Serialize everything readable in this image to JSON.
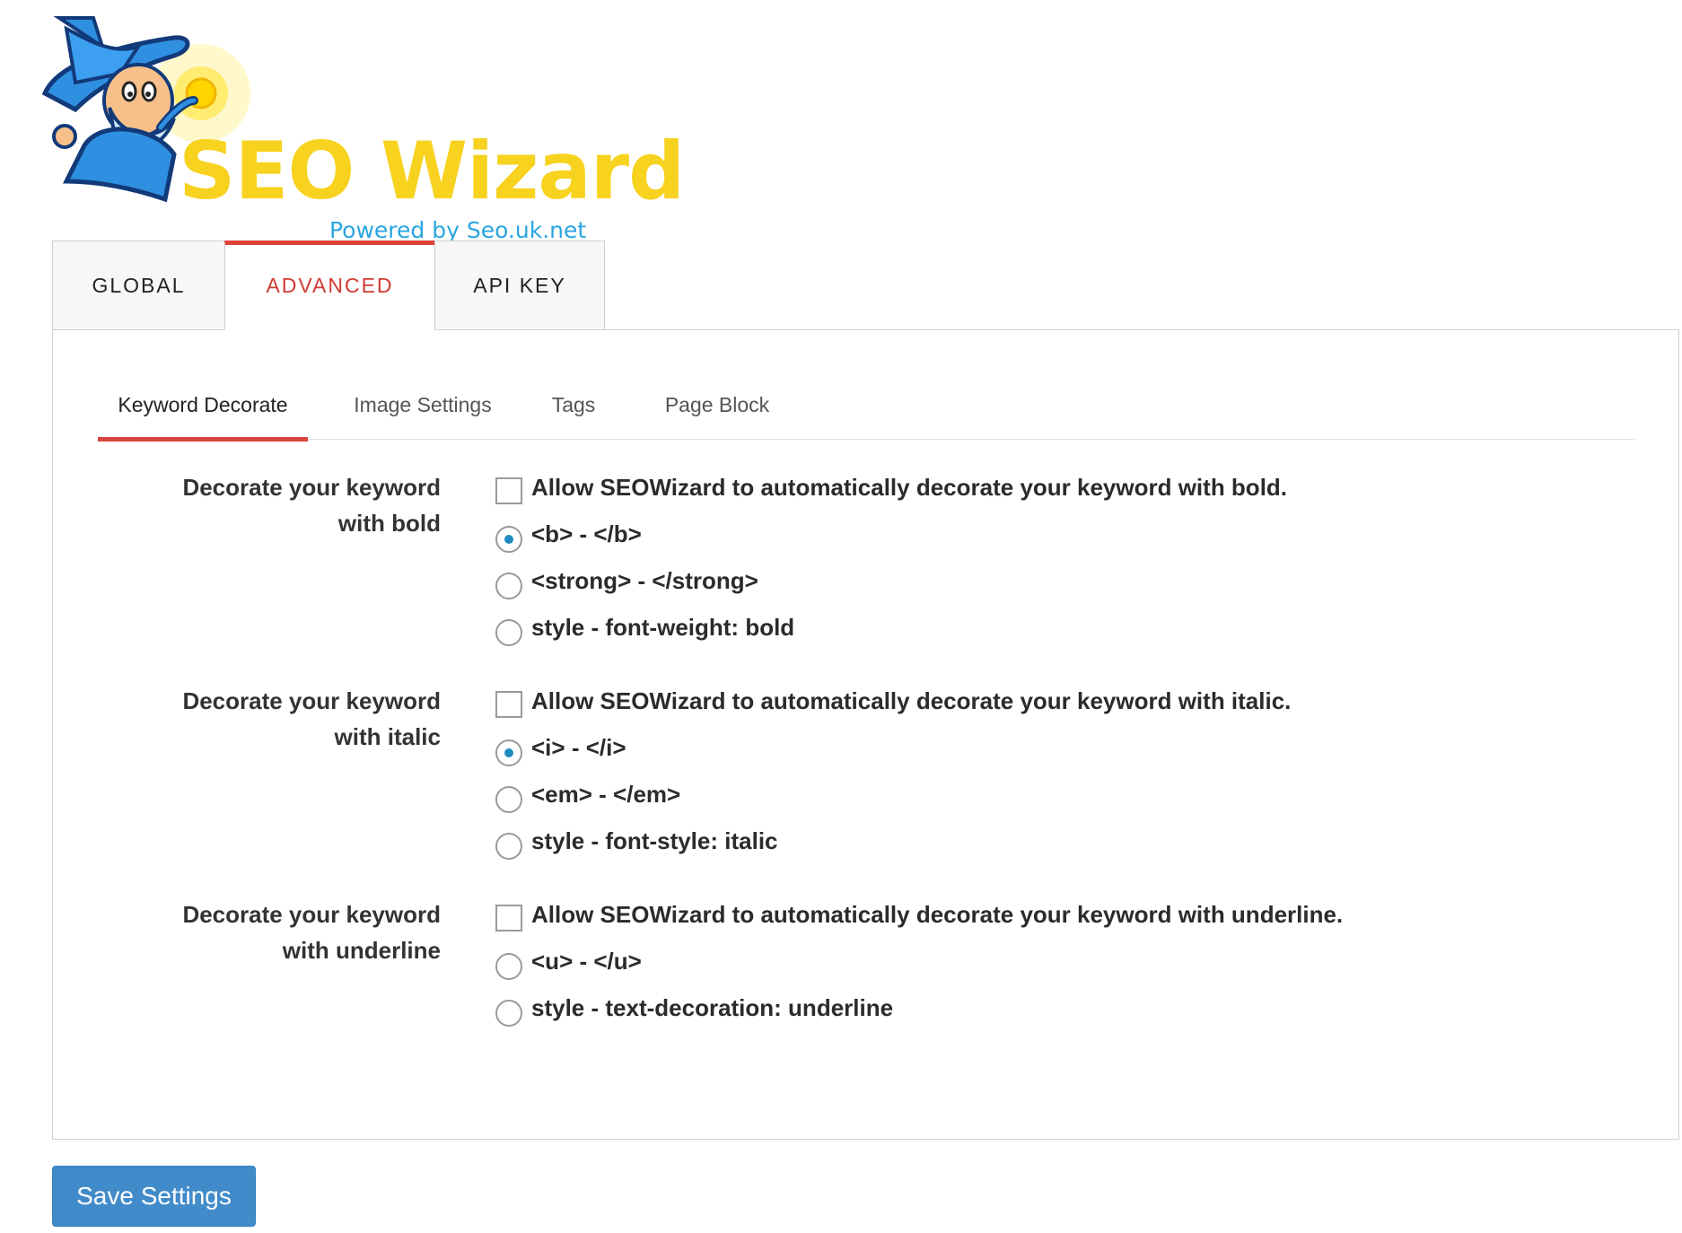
{
  "logo": {
    "title": "SEO Wizard",
    "subtitle": "Powered by Seo.uk.net",
    "icon": "wizard-mascot-icon"
  },
  "top_tabs": [
    {
      "label": "GLOBAL",
      "active": false
    },
    {
      "label": "ADVANCED",
      "active": true
    },
    {
      "label": "API KEY",
      "active": false
    }
  ],
  "sub_tabs": [
    {
      "label": "Keyword Decorate",
      "active": true
    },
    {
      "label": "Image Settings",
      "active": false
    },
    {
      "label": "Tags",
      "active": false
    },
    {
      "label": "Page Block",
      "active": false
    }
  ],
  "groups": {
    "bold": {
      "label_line1": "Decorate your keyword",
      "label_line2": "with bold",
      "allow": {
        "label": "Allow SEOWizard to automatically decorate your keyword with bold.",
        "checked": false
      },
      "options": [
        {
          "label": "<b> - </b>",
          "checked": true
        },
        {
          "label": "<strong> - </strong>",
          "checked": false
        },
        {
          "label": "style - font-weight: bold",
          "checked": false
        }
      ]
    },
    "italic": {
      "label_line1": "Decorate your keyword",
      "label_line2": "with italic",
      "allow": {
        "label": "Allow SEOWizard to automatically decorate your keyword with italic.",
        "checked": false
      },
      "options": [
        {
          "label": "<i> - </i>",
          "checked": true
        },
        {
          "label": "<em> - </em>",
          "checked": false
        },
        {
          "label": "style - font-style: italic",
          "checked": false
        }
      ]
    },
    "underline": {
      "label_line1": "Decorate your keyword",
      "label_line2": "with underline",
      "allow": {
        "label": "Allow SEOWizard to automatically decorate your keyword with underline.",
        "checked": false
      },
      "options": [
        {
          "label": "<u> - </u>",
          "checked": false
        },
        {
          "label": "style - text-decoration: underline",
          "checked": false
        }
      ]
    }
  },
  "save_button": {
    "label": "Save Settings"
  },
  "colors": {
    "accent_red": "#e0403a",
    "logo_yellow": "#f7d21e",
    "logo_blue": "#2aa6e0",
    "button_blue": "#428bca",
    "radio_dot": "#1e8cbe"
  }
}
